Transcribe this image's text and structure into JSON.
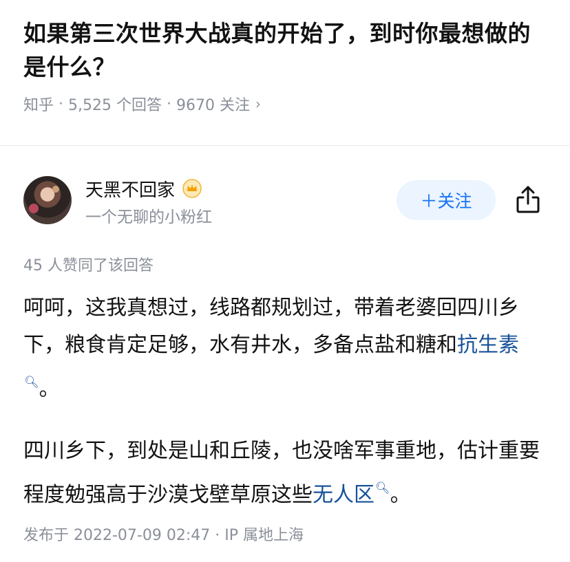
{
  "question": {
    "title": "如果第三次世界大战真的开始了，到时你最想做的是什么？",
    "source": "知乎",
    "answers": "5,525 个回答",
    "followers": "9670 关注",
    "chevron": "›"
  },
  "author": {
    "name": "天黑不回家",
    "description": "一个无聊的小粉红",
    "badge_icon": "crown-badge-icon",
    "follow_label": "＋关注"
  },
  "answer": {
    "votes": "45 人赞同了该回答",
    "p1_a": "呵呵，这我真想过，线路都规划过，带着老婆回四川乡下，粮食肯定足够，水有井水，多备点盐和糖和",
    "p1_link": "抗生素",
    "p1_b": "。",
    "p2_a": "四川乡下，到处是山和丘陵，也没啥军事重地，估计重要程度勉强高于沙漠戈壁草原这些",
    "p2_link": "无人区",
    "p2_b": "。",
    "published": "发布于 2022-07-09 02:47 · IP 属地上海"
  },
  "colors": {
    "accent": "#1772f6",
    "link": "#175199",
    "meta": "#8a8f99",
    "follow_bg": "#ebf4ff",
    "badge": "#f2a100"
  }
}
